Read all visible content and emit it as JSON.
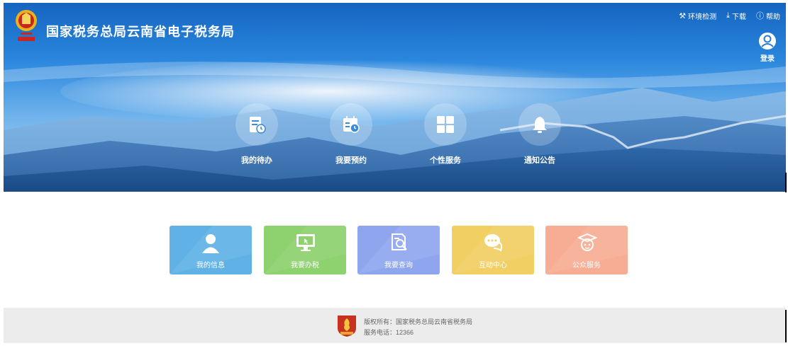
{
  "header": {
    "site_title": "国家税务总局云南省电子税务局",
    "links": [
      {
        "icon": "wrench-icon",
        "label": "环境检测"
      },
      {
        "icon": "download-icon",
        "label": "下载"
      },
      {
        "icon": "help-icon",
        "label": "帮助"
      }
    ],
    "login_label": "登录"
  },
  "banner_menu": [
    {
      "icon": "todo-icon",
      "label": "我的待办"
    },
    {
      "icon": "calendar-icon",
      "label": "我要预约"
    },
    {
      "icon": "grid-icon",
      "label": "个性服务"
    },
    {
      "icon": "bell-icon",
      "label": "通知公告"
    }
  ],
  "cards": [
    {
      "icon": "user-icon",
      "label": "我的信息",
      "color": "#5fb1e6"
    },
    {
      "icon": "monitor-icon",
      "label": "我要办税",
      "color": "#8ed16f"
    },
    {
      "icon": "search-doc-icon",
      "label": "我要查询",
      "color": "#8fa6ef"
    },
    {
      "icon": "chat-icon",
      "label": "互动中心",
      "color": "#f1cf63"
    },
    {
      "icon": "graduate-icon",
      "label": "公众服务",
      "color": "#f7ad93"
    }
  ],
  "footer": {
    "copyright": "版权所有：国家税务总局云南省税务局",
    "phone": "服务电话：12366"
  }
}
